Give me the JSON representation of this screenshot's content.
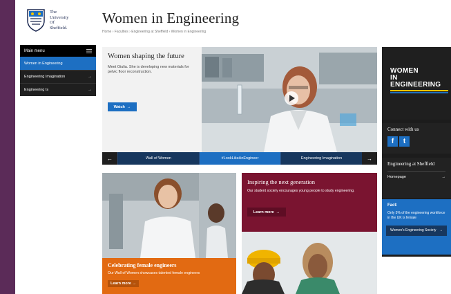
{
  "university": {
    "line1": "The",
    "line2": "University",
    "line3": "Of",
    "line4": "Sheffield."
  },
  "page": {
    "title": "Women in Engineering",
    "breadcrumb": "Home › Faculties › Engineering at Sheffield › Women in Engineering"
  },
  "menu": {
    "head": "Main menu",
    "items": [
      {
        "label": "Women in Engineering",
        "arrow": ""
      },
      {
        "label": "Engineering Imagination",
        "arrow": "→"
      },
      {
        "label": "Engineering Is",
        "arrow": "→"
      }
    ]
  },
  "hero": {
    "heading": "Women shaping the future",
    "text": "Meet Giulia. She is developing new materials for pelvic floor reconstruction.",
    "watch_label": "Watch",
    "watch_arrow": "→",
    "links": [
      "Wall of Women",
      "#LookLikeAnEngineer",
      "Engineering Imagination"
    ],
    "prev": "←",
    "next": "→"
  },
  "celebrating": {
    "heading": "Celebrating female engineers",
    "text": "Our Wall of Women showcases talented female engineers",
    "button": "Learn more →"
  },
  "inspiring": {
    "heading": "Inspiring the next generation",
    "text": "Our student society encourages young people to study engineering.",
    "button": "Learn more",
    "button_arrow": "→"
  },
  "sidebar": {
    "wie_line1": "WOMEN",
    "wie_line2": "IN",
    "wie_line3": "ENGINEERING",
    "connect_heading": "Connect with us",
    "facebook": "f",
    "twitter": "t",
    "eng_heading": "Engineering at Sheffield",
    "homepage_label": "Homepage",
    "homepage_arrow": "→",
    "fact_heading": "Fact:",
    "fact_text": "Only 5% of the engineering workforce in the UK is female",
    "society_label": "Women's Engineering Society",
    "society_arrow": "→"
  },
  "colors": {
    "purple": "#5b2b58",
    "blue": "#1d6fc2",
    "navy": "#17375e",
    "orange": "#e26a12",
    "maroon": "#7a1430"
  }
}
